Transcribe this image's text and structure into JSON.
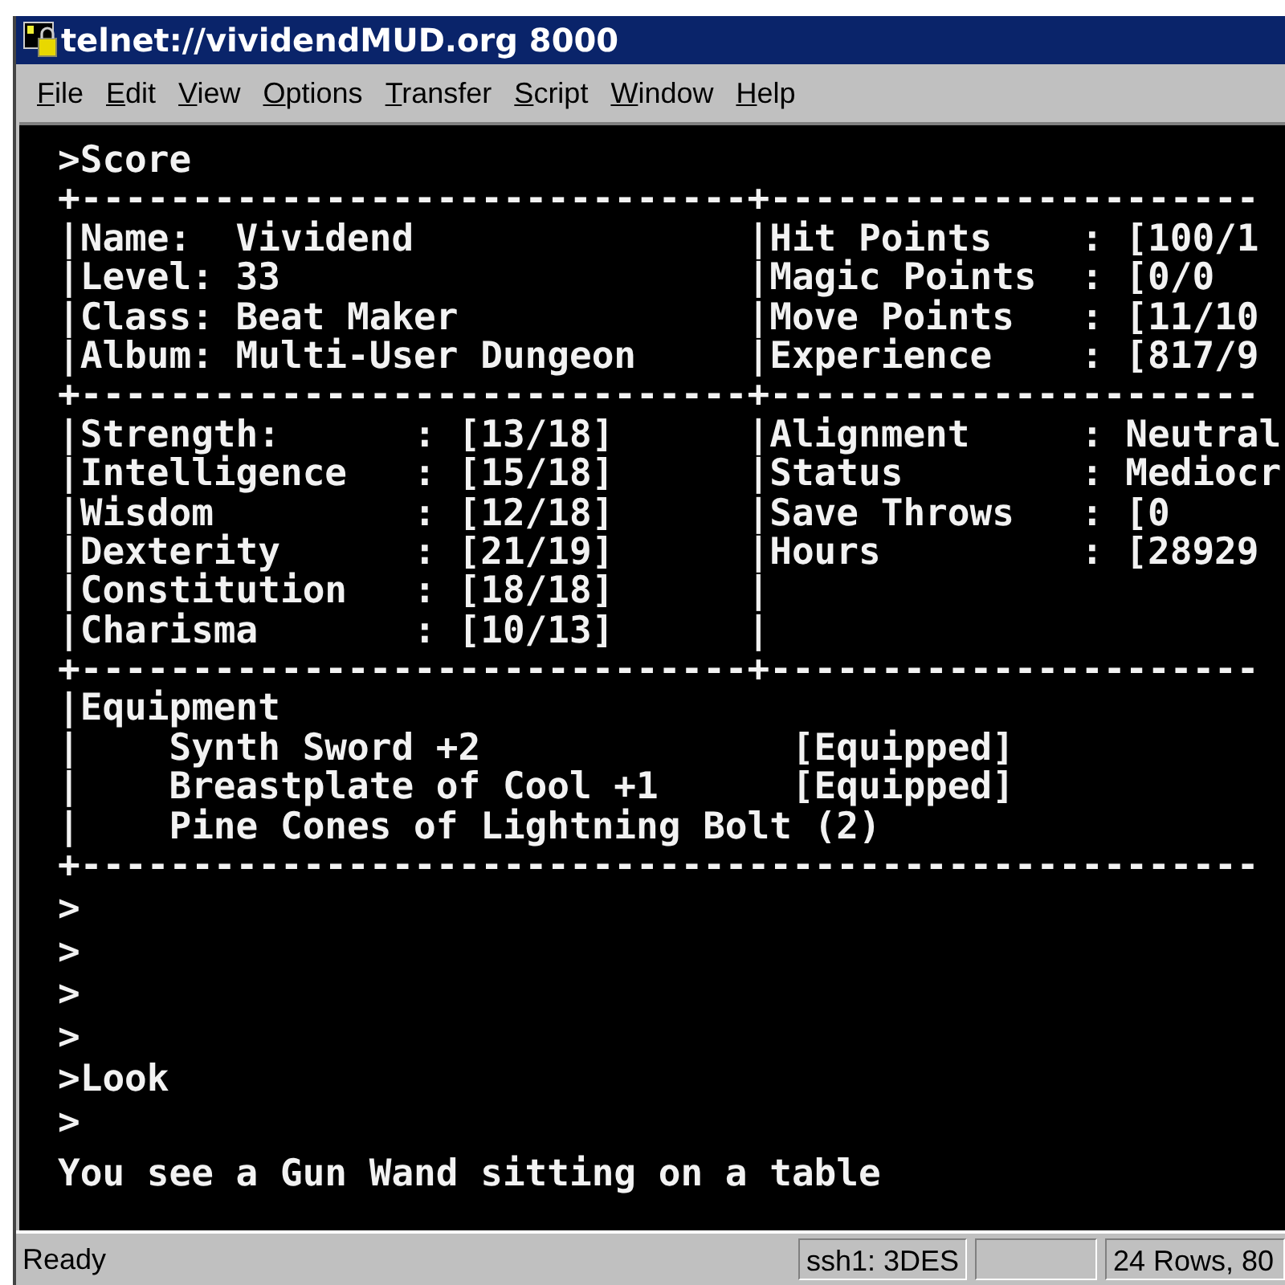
{
  "window": {
    "title": "telnet://vividendMUD.org 8000"
  },
  "menu": [
    "File",
    "Edit",
    "View",
    "Options",
    "Transfer",
    "Script",
    "Window",
    "Help"
  ],
  "terminal": {
    "lines": [
      ">Score",
      "+------------------------------+----------------------",
      "|Name:  Vividend               |Hit Points    : [100/1",
      "|Level: 33                     |Magic Points  : [0/0",
      "|Class: Beat Maker             |Move Points   : [11/10",
      "|Album: Multi-User Dungeon     |Experience    : [817/9",
      "+------------------------------+----------------------",
      "|Strength:      : [13/18]      |Alignment     : Neutral",
      "|Intelligence   : [15/18]      |Status        : Mediocr",
      "|Wisdom         : [12/18]      |Save Throws   : [0",
      "|Dexterity      : [21/19]      |Hours         : [28929",
      "|Constitution   : [18/18]      |",
      "|Charisma       : [10/13]      |",
      "+------------------------------+----------------------",
      "|Equipment",
      "|    Synth Sword +2              [Equipped]",
      "|    Breastplate of Cool +1      [Equipped]",
      "|    Pine Cones of Lightning Bolt (2)",
      "+-----------------------------------------------------"
    ],
    "prompts": [
      ">",
      ">",
      ">",
      ">",
      ">Look",
      ">",
      "You see a Gun Wand sitting on a table"
    ]
  },
  "status_bar": {
    "message": "Ready",
    "cipher": "ssh1: 3DES",
    "size": "24 Rows, 80"
  }
}
